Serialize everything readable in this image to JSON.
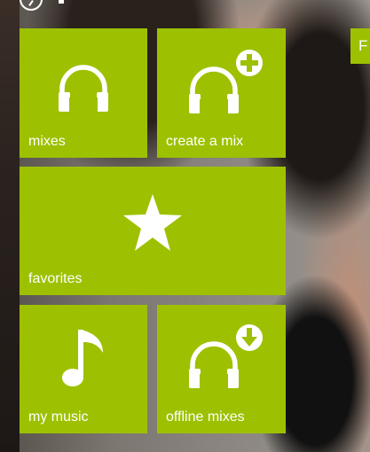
{
  "peek_tile": {
    "label": "F"
  },
  "tiles": [
    {
      "label": "mixes",
      "icon": "headphones-icon"
    },
    {
      "label": "create a mix",
      "icon": "headphones-plus-icon"
    },
    {
      "label": "favorites",
      "icon": "star-icon"
    },
    {
      "label": "my music",
      "icon": "music-note-icon"
    },
    {
      "label": "offline mixes",
      "icon": "headphones-download-icon"
    }
  ],
  "colors": {
    "tile_background": "#9dc100",
    "text": "#ffffff"
  }
}
